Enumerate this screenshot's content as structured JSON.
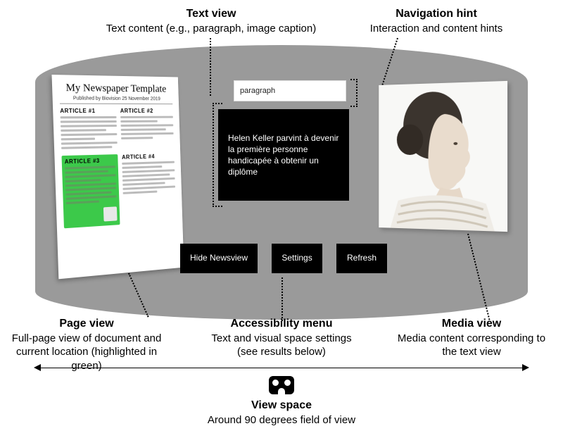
{
  "labels": {
    "textview": {
      "title": "Text view",
      "sub": "Text content (e.g., paragraph, image caption)"
    },
    "navhint": {
      "title": "Navigation hint",
      "sub": "Interaction and content hints"
    },
    "pageview": {
      "title": "Page view",
      "sub": "Full-page view of document and current location (highlighted in green)"
    },
    "accmenu": {
      "title": "Accessibility menu",
      "sub": "Text and visual space settings (see results below)"
    },
    "mediaview": {
      "title": "Media view",
      "sub": "Media content corresponding to the text view"
    },
    "viewspace": {
      "title": "View space",
      "sub": "Around 90 degrees field of view"
    }
  },
  "page": {
    "title": "My Newspaper Template",
    "published": "Published by Biovision 25 November 2019",
    "article1": "ARTICLE #1",
    "article2": "ARTICLE #2",
    "article3": "ARTICLE #3",
    "article4": "ARTICLE #4"
  },
  "hint": {
    "label": "paragraph"
  },
  "text_content": "Helen Keller parvint à devenir la première personne handicapée à obtenir un diplôme",
  "buttons": {
    "hide": "Hide Newsview",
    "settings": "Settings",
    "refresh": "Refresh"
  }
}
